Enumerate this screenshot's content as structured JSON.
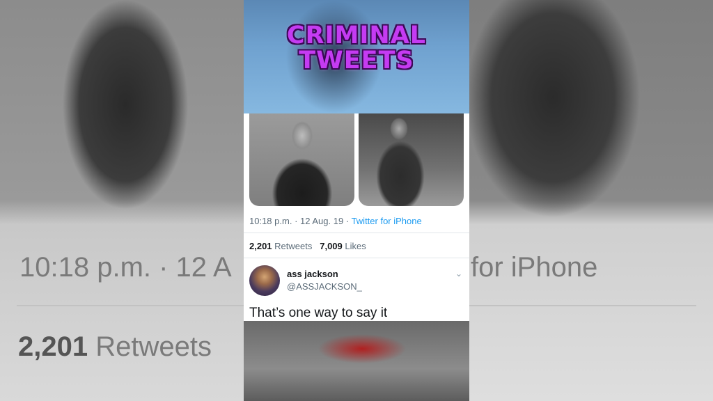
{
  "overlay": {
    "title_line1": "CRIMINAL",
    "title_line2": "TWEETS"
  },
  "tweet": {
    "time": "10:18 p.m.",
    "date": "12 Aug. 19",
    "source": "Twitter for iPhone",
    "retweets_count": "2,201",
    "retweets_label": "Retweets",
    "likes_count": "7,009",
    "likes_label": "Likes"
  },
  "reply": {
    "name": "ass jackson",
    "handle": "@ASSJACKSON_",
    "text": "That’s one way to say it"
  },
  "background": {
    "left_meta": "10:18 p.m. · 12 A",
    "right_meta": "for iPhone",
    "left_count": "2,201",
    "left_label": "Retweets"
  },
  "icons": {
    "chevron": "chevron-down-icon"
  },
  "colors": {
    "title": "#c53bf2",
    "link": "#1d9bf0",
    "muted": "#5b6b78"
  }
}
